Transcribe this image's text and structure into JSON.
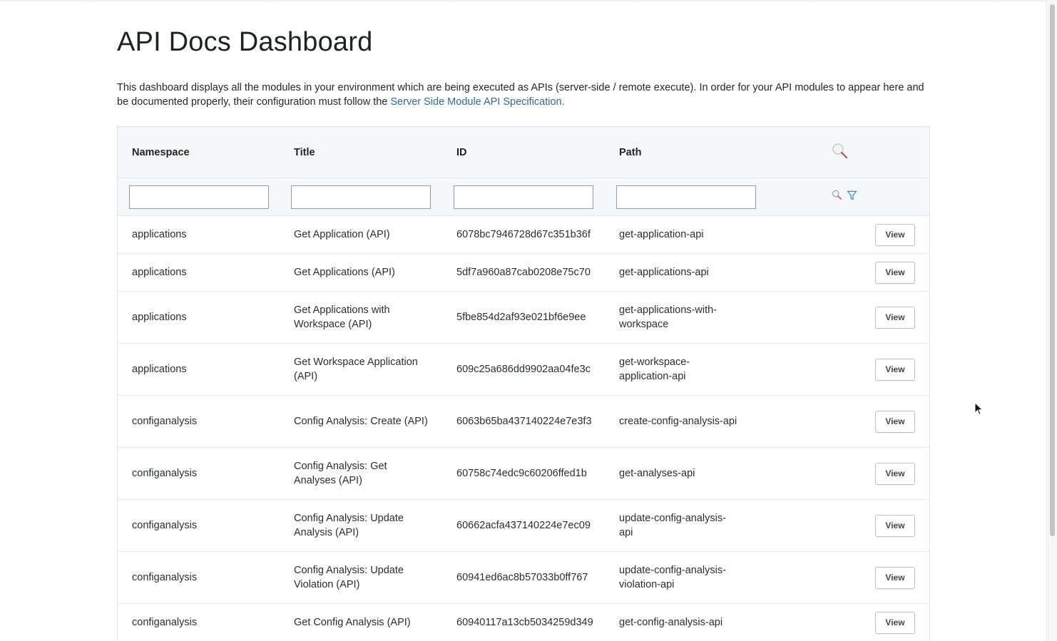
{
  "page": {
    "title": "API Docs Dashboard",
    "intro_text": "This dashboard displays all the modules in your environment which are being executed as APIs (server-side / remote execute). In order for your API modules to appear here and be documented properly, their configuration must follow the ",
    "intro_link": "Server Side Module API Specification."
  },
  "table": {
    "headers": {
      "namespace": "Namespace",
      "title": "Title",
      "id": "ID",
      "path": "Path"
    },
    "view_label": "View",
    "rows": [
      {
        "namespace": "applications",
        "title": "Get Application (API)",
        "id": "6078bc7946728d67c351b36f",
        "path": "get-application-api"
      },
      {
        "namespace": "applications",
        "title": "Get Applications (API)",
        "id": "5df7a960a87cab0208e75c70",
        "path": "get-applications-api"
      },
      {
        "namespace": "applications",
        "title": "Get Applications with Workspace (API)",
        "id": "5fbe854d2af93e021bf6e9ee",
        "path": "get-applications-with-workspace"
      },
      {
        "namespace": "applications",
        "title": "Get Workspace Application (API)",
        "id": "609c25a686dd9902aa04fe3c",
        "path": "get-workspace-application-api"
      },
      {
        "namespace": "configanalysis",
        "title": "Config Analysis: Create (API)",
        "id": "6063b65ba437140224e7e3f3",
        "path": "create-config-analysis-api"
      },
      {
        "namespace": "configanalysis",
        "title": "Config Analysis: Get Analyses (API)",
        "id": "60758c74edc9c60206ffed1b",
        "path": "get-analyses-api"
      },
      {
        "namespace": "configanalysis",
        "title": "Config Analysis: Update Analysis (API)",
        "id": "60662acfa437140224e7ec09",
        "path": "update-config-analysis-api"
      },
      {
        "namespace": "configanalysis",
        "title": "Config Analysis: Update Violation (API)",
        "id": "60941ed6ac8b57033b0ff767",
        "path": "update-config-analysis-violation-api"
      },
      {
        "namespace": "configanalysis",
        "title": "Get Config Analysis (API)",
        "id": "60940117a13cb5034259d349",
        "path": "get-config-analysis-api"
      }
    ]
  },
  "icons": {
    "header_search": "magnifier-icon",
    "filter_search": "magnifier-icon",
    "filter": "funnel-icon"
  },
  "colors": {
    "link": "#2e6b8e",
    "header_bg": "#f5f7f9",
    "filter_icon": "#3a8dc4"
  }
}
